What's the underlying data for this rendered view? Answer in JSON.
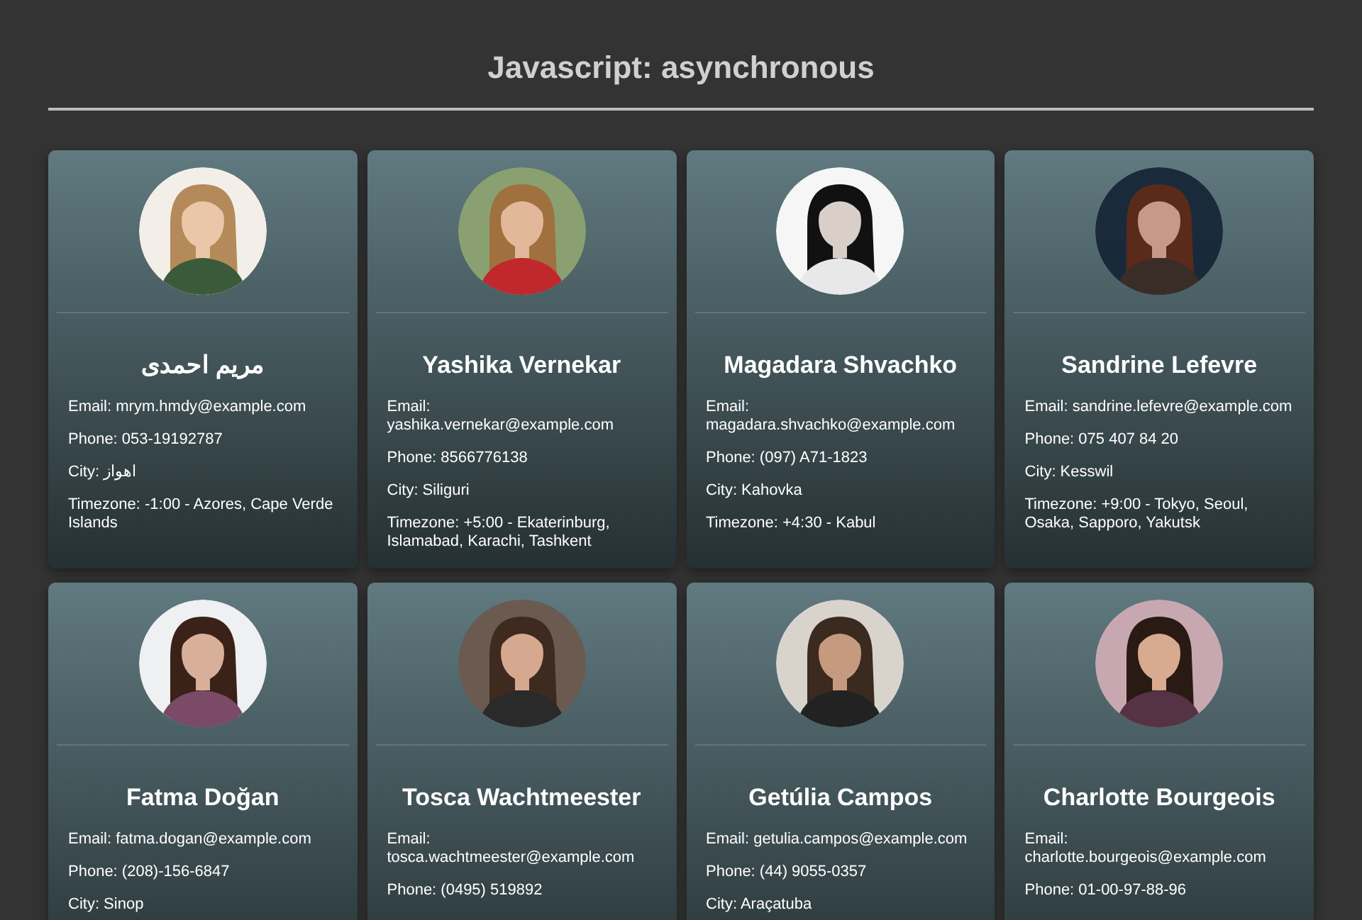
{
  "title": "Javascript: asynchronous",
  "users": [
    {
      "name": "مریم احمدی",
      "lines": [
        "Email: mrym.hmdy@example.com",
        "Phone: 053-19192787",
        "City: اهواز",
        "Timezone: -1:00 - Azores, Cape Verde Islands"
      ]
    },
    {
      "name": "Yashika Vernekar",
      "lines": [
        "Email: yashika.vernekar@example.com",
        "Phone: 8566776138",
        "City: Siliguri",
        "Timezone: +5:00 - Ekaterinburg, Islamabad, Karachi, Tashkent"
      ]
    },
    {
      "name": "Magadara Shvachko",
      "lines": [
        "Email: magadara.shvachko@example.com",
        "Phone: (097) A71-1823",
        "City: Kahovka",
        "Timezone: +4:30 - Kabul"
      ]
    },
    {
      "name": "Sandrine Lefevre",
      "lines": [
        "Email: sandrine.lefevre@example.com",
        "Phone: 075 407 84 20",
        "City: Kesswil",
        "Timezone: +9:00 - Tokyo, Seoul, Osaka, Sapporo, Yakutsk"
      ]
    },
    {
      "name": "Fatma Doğan",
      "lines": [
        "Email: fatma.dogan@example.com",
        "Phone: (208)-156-6847",
        "City: Sinop"
      ]
    },
    {
      "name": "Tosca Wachtmeester",
      "lines": [
        "Email: tosca.wachtmeester@example.com",
        "Phone: (0495) 519892"
      ]
    },
    {
      "name": "Getúlia Campos",
      "lines": [
        "Email: getulia.campos@example.com",
        "Phone: (44) 9055-0357",
        "City: Araçatuba"
      ]
    },
    {
      "name": "Charlotte Bourgeois",
      "lines": [
        "Email: charlotte.bourgeois@example.com",
        "Phone: 01-00-97-88-96"
      ]
    }
  ]
}
